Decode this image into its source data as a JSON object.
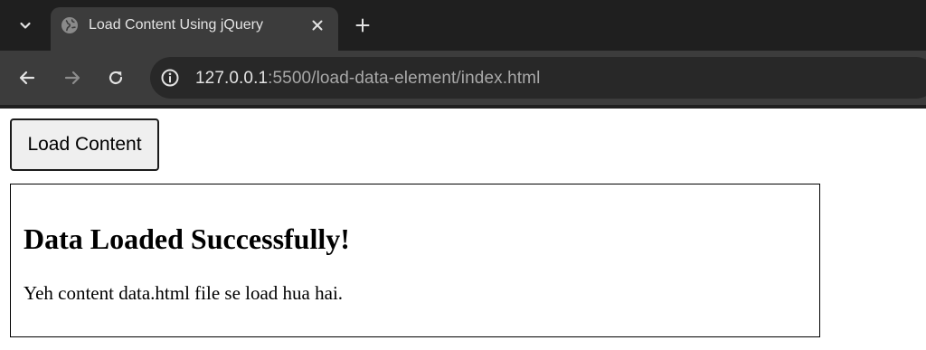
{
  "browser": {
    "tab": {
      "title": "Load Content Using jQuery",
      "favicon": "globe-icon"
    },
    "address_bar": {
      "host": "127.0.0.1",
      "rest": ":5500/load-data-element/index.html"
    },
    "icons": {
      "tab_search": "chevron-down-icon",
      "tab_close": "close-icon",
      "new_tab": "plus-icon",
      "back": "arrow-left-icon",
      "forward": "arrow-right-icon",
      "reload": "reload-icon",
      "site_info": "info-icon"
    },
    "colors": {
      "tabstrip": "#1f1f1f",
      "toolbar": "#3c3c3c",
      "omnibox": "#282828"
    }
  },
  "page": {
    "load_button_label": "Load Content",
    "content": {
      "heading": "Data Loaded Successfully!",
      "paragraph": "Yeh content data.html file se load hua hai."
    }
  }
}
